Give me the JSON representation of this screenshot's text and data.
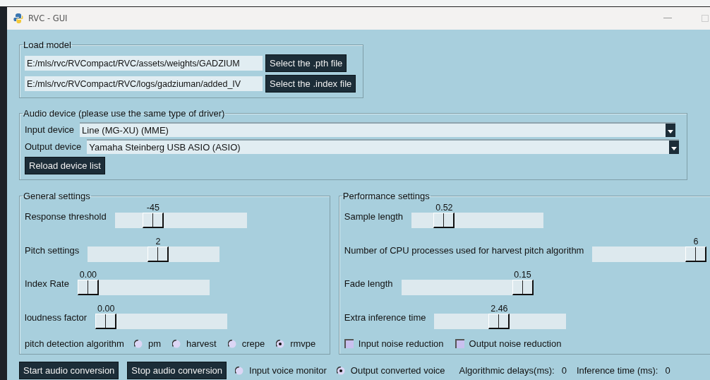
{
  "window": {
    "title": "RVC - GUI"
  },
  "load_model": {
    "title": "Load model",
    "files": [
      {
        "value": "E:/mls/rvc/RVCompact/RVC/assets/weights/GADZIUM",
        "button": "Select the .pth file"
      },
      {
        "value": "E:/mls/rvc/RVCompact/RVC/logs/gadziuman/added_IV",
        "button": "Select the .index file"
      }
    ]
  },
  "audio_device": {
    "title": "Audio device (please use the same type of driver)",
    "selects": [
      {
        "label": "Input device",
        "value": "Line (MG-XU) (MME)"
      },
      {
        "label": "Output device",
        "value": "Yamaha Steinberg USB ASIO (ASIO)"
      }
    ],
    "reload_button": "Reload device list"
  },
  "general_settings": {
    "title": "General settings",
    "sliders": [
      {
        "label": "Response threshold",
        "reading": "-45",
        "level": 0.25
      },
      {
        "label": "Pitch settings",
        "reading": "2",
        "level": 0.54
      },
      {
        "label": "Index Rate",
        "reading": "0.00",
        "level": 0
      },
      {
        "label": "loudness factor",
        "reading": "0.00",
        "level": 0
      }
    ],
    "pitch_algorithm": {
      "label": "pitch detection algorithm",
      "options": [
        {
          "label": "pm",
          "selected": false
        },
        {
          "label": "harvest",
          "selected": false
        },
        {
          "label": "crepe",
          "selected": false
        },
        {
          "label": "rmvpe",
          "selected": true
        }
      ]
    }
  },
  "performance_settings": {
    "title": "Performance settings",
    "sliders": [
      {
        "label": "Sample length",
        "reading": "0.52",
        "level": 0.2
      },
      {
        "label": "Number of CPU processes used for harvest pitch algorithm",
        "reading": "6",
        "level": 1
      },
      {
        "label": "Fade length",
        "reading": "0.15",
        "level": 1
      },
      {
        "label": "Extra inference time",
        "reading": "2.46",
        "level": 0.49
      }
    ],
    "checkboxes": [
      {
        "label": "Input noise reduction",
        "checked": false
      },
      {
        "label": "Output noise reduction",
        "checked": false
      }
    ]
  },
  "bottom_bar": {
    "buttons": [
      "Start audio conversion",
      "Stop audio conversion"
    ],
    "monitor_options": [
      {
        "label": "Input voice monitor",
        "selected": false
      },
      {
        "label": "Output converted voice",
        "selected": true
      }
    ],
    "readouts": [
      {
        "label": "Algorithmic delays(ms):",
        "value": "0"
      },
      {
        "label": "Inference time (ms):",
        "value": "0"
      }
    ]
  }
}
